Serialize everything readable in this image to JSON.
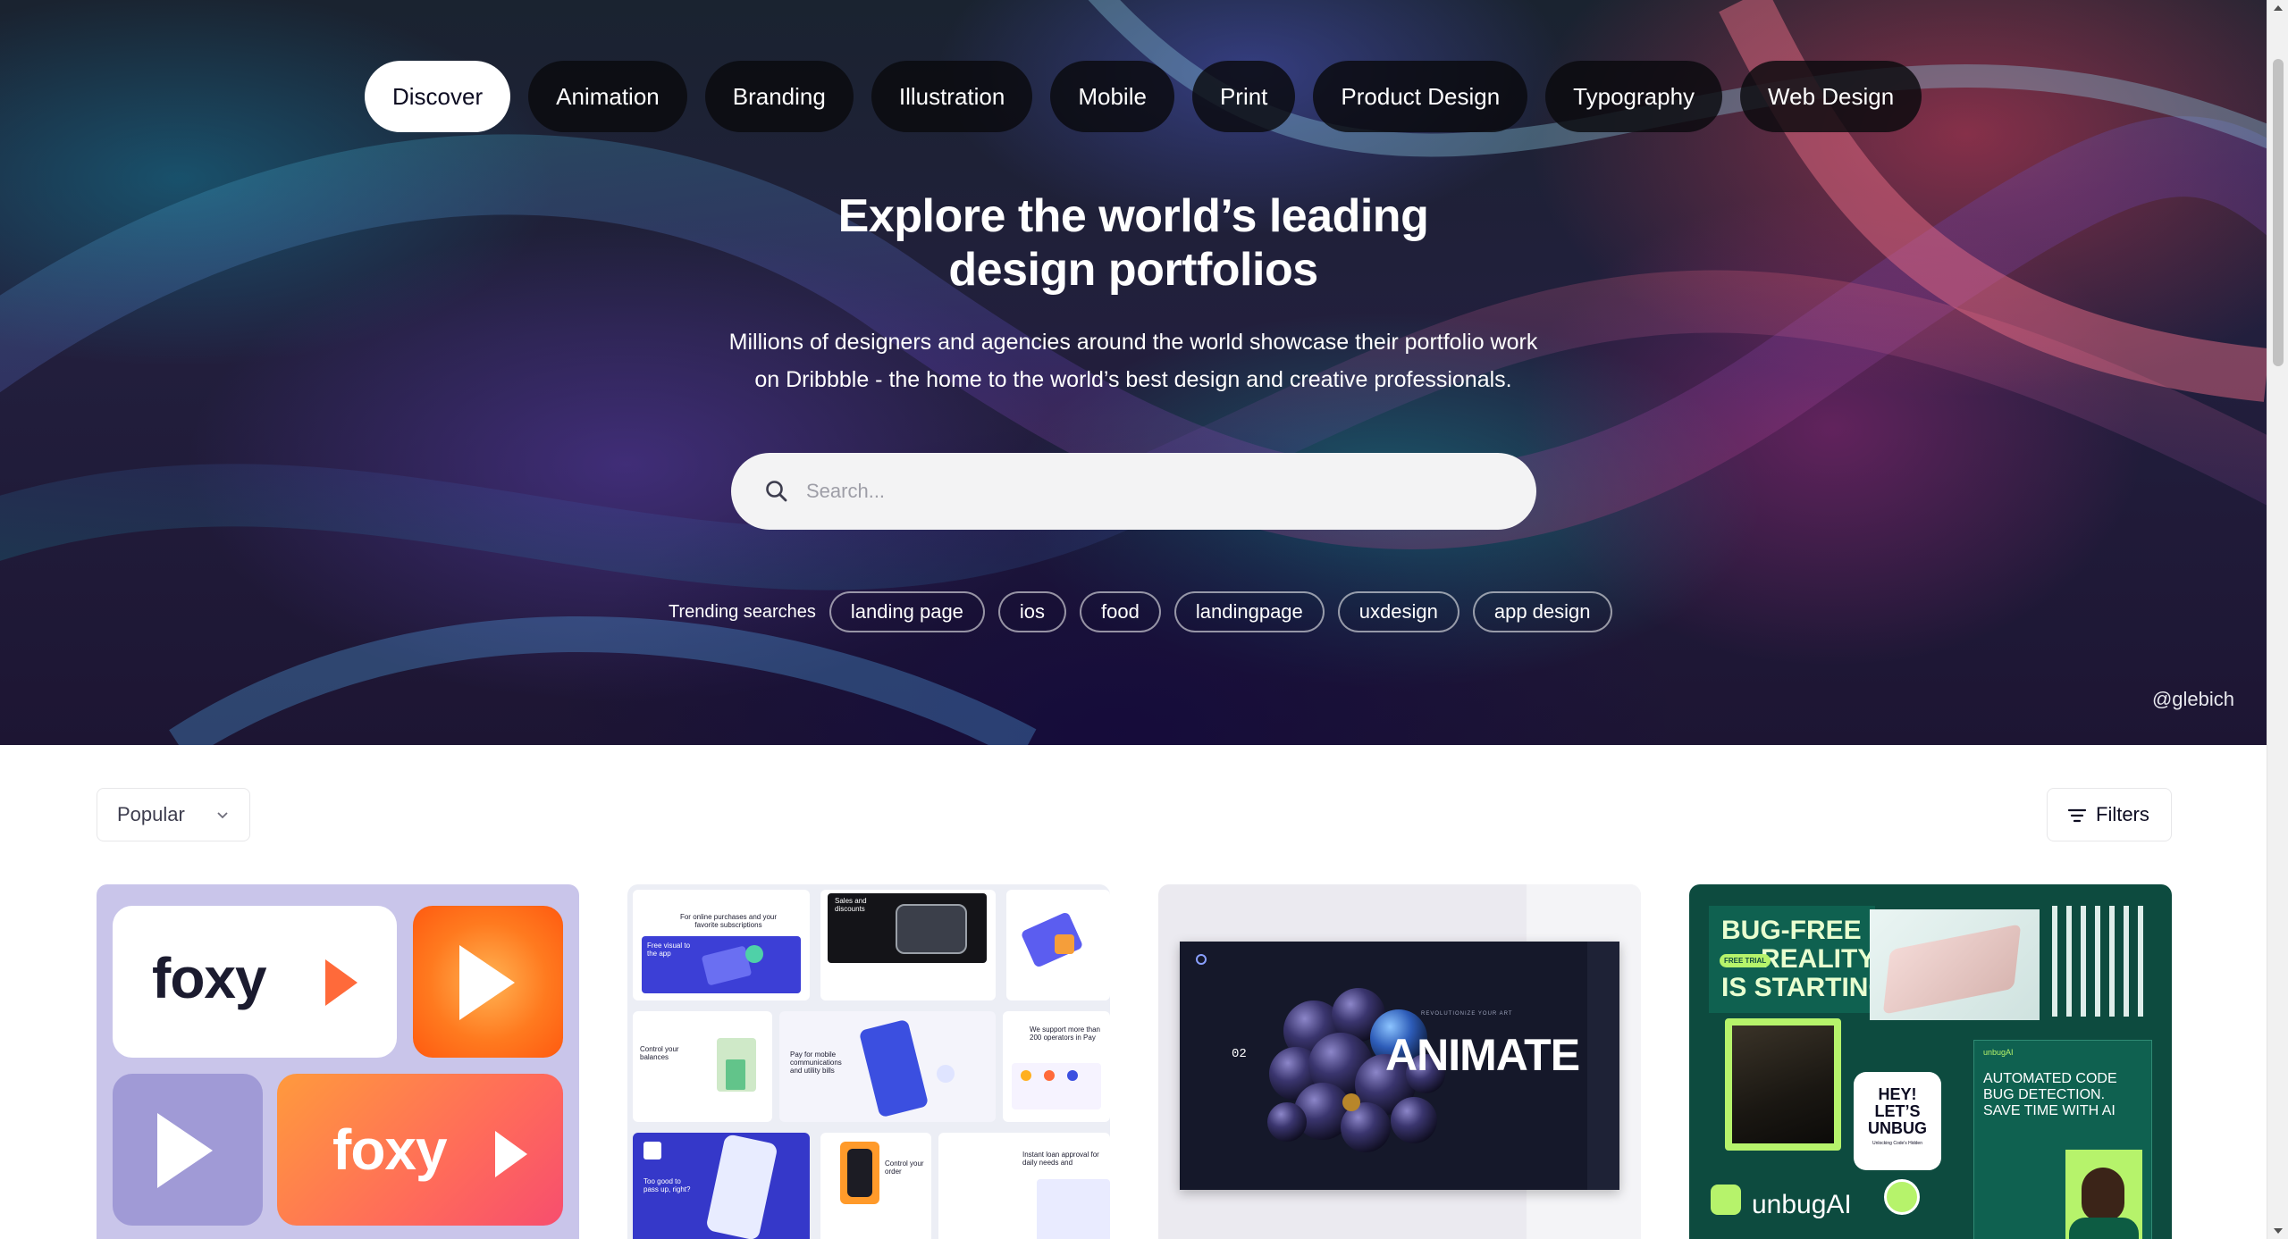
{
  "categories": [
    "Discover",
    "Animation",
    "Branding",
    "Illustration",
    "Mobile",
    "Print",
    "Product Design",
    "Typography",
    "Web Design"
  ],
  "active_category": "Discover",
  "hero": {
    "title_line1": "Explore the world’s leading",
    "title_line2": "design portfolios",
    "subtitle_line1": "Millions of designers and agencies around the world showcase their portfolio work",
    "subtitle_line2": "on Dribbble - the home to the world’s best design and creative professionals.",
    "credit": "@glebich"
  },
  "search": {
    "placeholder": "Search...",
    "value": ""
  },
  "trending": {
    "label": "Trending searches",
    "items": [
      "landing page",
      "ios",
      "food",
      "landingpage",
      "uxdesign",
      "app design"
    ]
  },
  "controls": {
    "sort_selected": "Popular",
    "filters_label": "Filters"
  },
  "shots": {
    "shot1": {
      "brand_a": "foxy",
      "brand_b": "foxy"
    },
    "shot2": {
      "t1": "For online purchases and your favorite subscriptions",
      "t2": "Sales and discounts",
      "t3": "Control your balances",
      "t4": "Pay for mobile communications and utility bills",
      "t5": "We support more than 200 operators in Pay",
      "t6": "Too good to pass up, right?",
      "t7": "Control your order",
      "t8": "Instant loan approval for daily needs and",
      "t9": "Free visual to the app"
    },
    "shot3": {
      "heading": "ANIMATE",
      "num": "02",
      "tag": "REVOLUTIONIZE YOUR ART"
    },
    "shot4": {
      "headline_1": "BUG-FREE",
      "headline_2": "REALITY",
      "headline_3": "IS STARTING",
      "badge": "FREE TRIAL",
      "bubble_1": "HEY!",
      "bubble_2": "LET’S",
      "bubble_3": "UNBUG",
      "bubble_small": "Unlocking Code's Hidden",
      "panel_brand": "unbugAI",
      "panel_text_1": "AUTOMATED CODE",
      "panel_text_2": "BUG DETECTION.",
      "panel_text_3": "SAVE TIME WITH AI",
      "brand": "unbugAI"
    }
  },
  "colors": {
    "accent_dark": "#0d0c22",
    "search_bg": "#f3f3f4",
    "shot4_bg": "#0d4b3f",
    "shot4_accent": "#b6f36b"
  }
}
